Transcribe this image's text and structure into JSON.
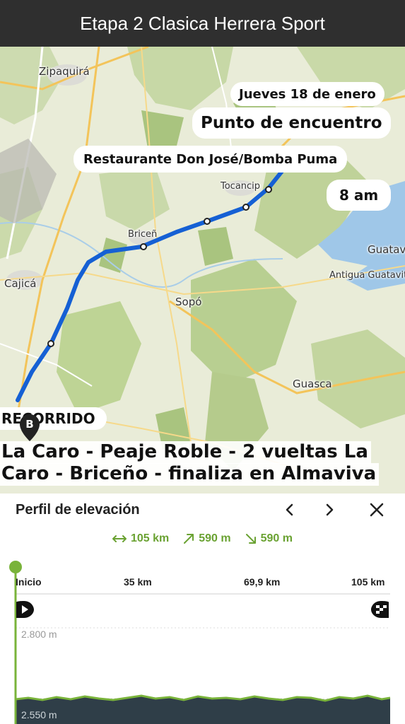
{
  "app": {
    "title": "Etapa 2 Clasica Herrera Sport"
  },
  "map": {
    "places": [
      "Zipaquirá",
      "Tocancipá",
      "Briceño",
      "Cajicá",
      "Sopó",
      "Guasca",
      "Guatavita",
      "Antigua Guatavita"
    ],
    "places_visible": [
      "Zipaquirá",
      "Tocancip",
      "Briceñ",
      "Cajicá",
      "Sopó",
      "Guasca",
      "Guatav",
      "Antigua Guatavit"
    ],
    "marker_label": "B",
    "route_color": "#1560d4"
  },
  "info": {
    "date": "Jueves 18 de enero",
    "meeting_heading": "Punto de encuentro",
    "location": "Restaurante Don José/Bomba Puma",
    "time": "8 am",
    "route_heading": "RECORRIDO",
    "route_line1": "La Caro - Peaje Roble - 2 vueltas La",
    "route_line2": "Caro - Briceño - finaliza en Almaviva"
  },
  "elevation": {
    "title": "Perfil de elevación",
    "distance": "105 km",
    "ascent": "590 m",
    "descent": "590 m",
    "x_ticks": [
      "Inicio",
      "35 km",
      "69,9 km",
      "105 km"
    ],
    "y_labels": [
      "2.800 m",
      "2.550 m"
    ],
    "accent": "#6aa232"
  },
  "icons": {
    "prev": "chevron-left-icon",
    "next": "chevron-right-icon",
    "close": "close-icon",
    "start": "play-flag-icon",
    "finish": "finish-flag-icon"
  }
}
